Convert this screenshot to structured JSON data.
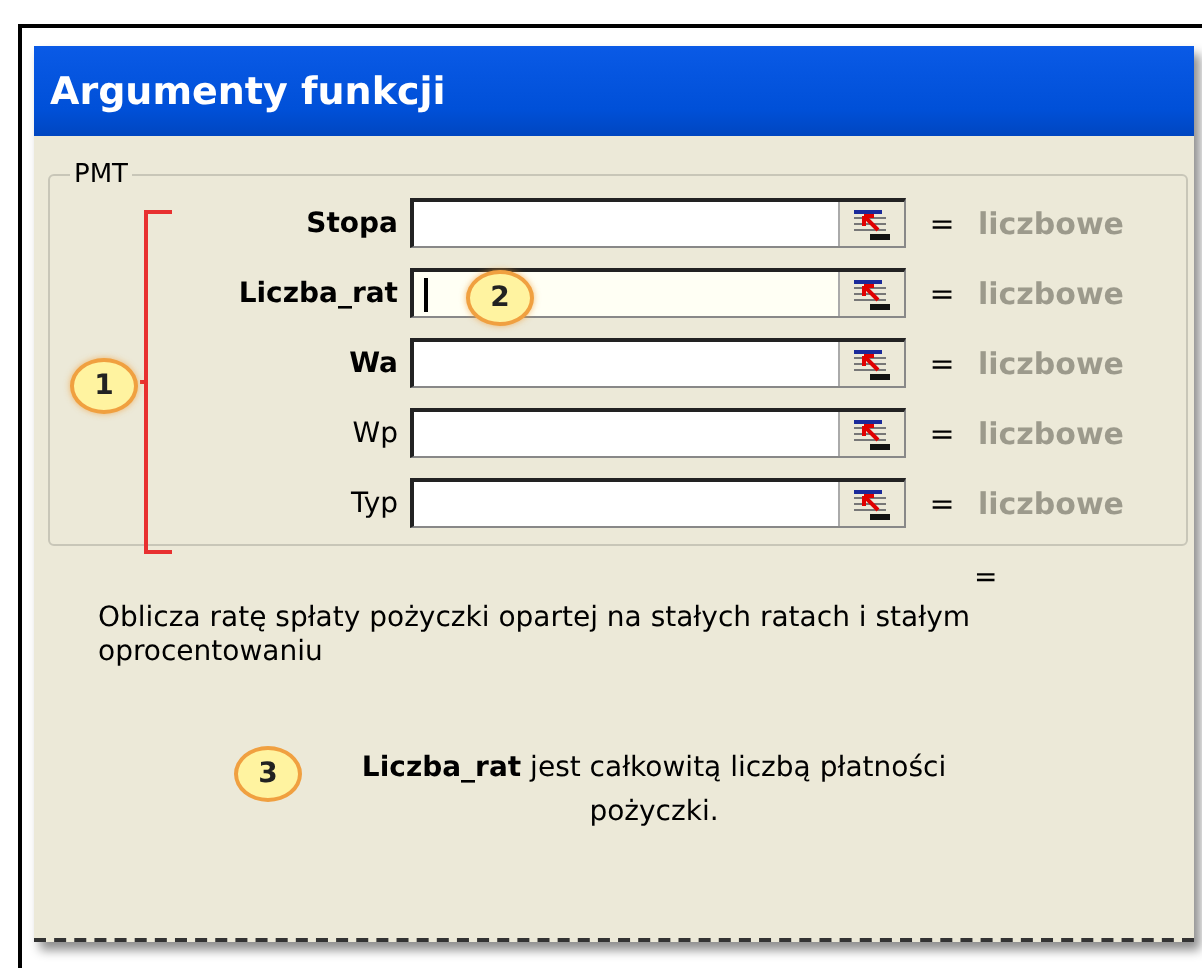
{
  "window": {
    "title": "Argumenty funkcji"
  },
  "function_group": {
    "label": "PMT",
    "arguments": [
      {
        "name": "Stopa",
        "required": true,
        "focused": false,
        "equals": "=",
        "result": "liczbowe"
      },
      {
        "name": "Liczba_rat",
        "required": true,
        "focused": true,
        "equals": "=",
        "result": "liczbowe"
      },
      {
        "name": "Wa",
        "required": true,
        "focused": false,
        "equals": "=",
        "result": "liczbowe"
      },
      {
        "name": "Wp",
        "required": false,
        "focused": false,
        "equals": "=",
        "result": "liczbowe"
      },
      {
        "name": "Typ",
        "required": false,
        "focused": false,
        "equals": "=",
        "result": "liczbowe"
      }
    ]
  },
  "callouts": {
    "arguments": "1",
    "input": "2",
    "help": "3"
  },
  "formula_result": "=",
  "description": "Oblicza ratę spłaty pożyczki opartej na stałych ratach i stałym oprocentowaniu",
  "help": "**Liczba_rat** jest całkowitą liczbą płatności pożyczki."
}
